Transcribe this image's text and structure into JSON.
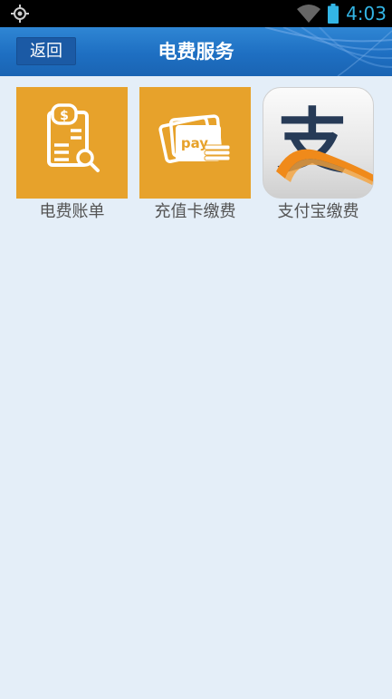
{
  "status_bar": {
    "time": "4:03",
    "left_icon": "gps-icon",
    "wifi_icon": "wifi-icon",
    "battery_icon": "battery-icon"
  },
  "header": {
    "back_label": "返回",
    "title": "电费服务"
  },
  "tiles": [
    {
      "label": "电费账单",
      "icon": "bill-search-icon",
      "color": "#e7a22b"
    },
    {
      "label": "充值卡缴费",
      "icon": "pay-card-icon",
      "color": "#e7a22b",
      "icon_text": "pay"
    },
    {
      "label": "支付宝缴费",
      "icon": "alipay-icon",
      "icon_text": "支"
    }
  ],
  "colors": {
    "header_blue": "#1e6fc2",
    "background": "#e4eef8",
    "status_accent": "#33b5e5",
    "tile_orange": "#e7a22b"
  }
}
